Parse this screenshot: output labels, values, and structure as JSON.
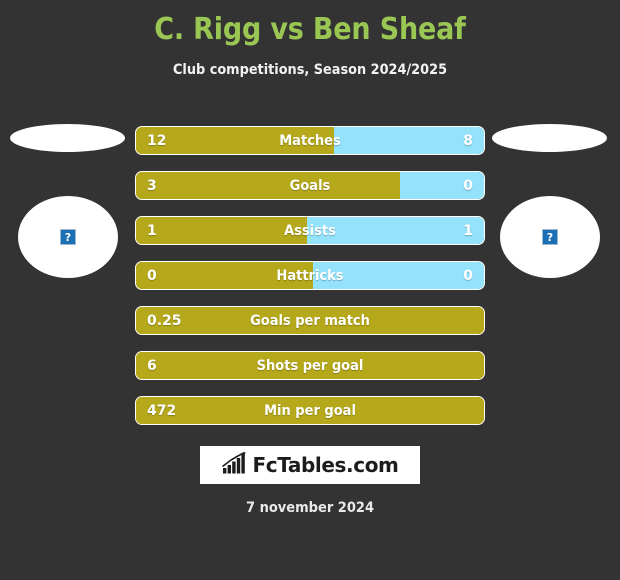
{
  "header": {
    "title": "C. Rigg vs Ben Sheaf",
    "subtitle": "Club competitions, Season 2024/2025",
    "title_color": "#9ac653"
  },
  "teams": {
    "home": {
      "club_badge_icon": "club-crest-placeholder",
      "player_photo_icon": "broken-image-icon",
      "broken_image_glyph": "?"
    },
    "away": {
      "club_badge_icon": "club-crest-placeholder",
      "player_photo_icon": "broken-image-icon",
      "broken_image_glyph": "?"
    }
  },
  "colors": {
    "background": "#333333",
    "home_bar": "#b5a81a",
    "away_bar": "#94e2fb",
    "bar_border": "#ffffff",
    "text": "#ffffff"
  },
  "chart_data": {
    "type": "bar",
    "title": "C. Rigg vs Ben Sheaf",
    "subtitle": "Club competitions, Season 2024/2025",
    "orientation": "horizontal-diverging",
    "legend": [
      "C. Rigg",
      "Ben Sheaf"
    ],
    "categories": [
      "Matches",
      "Goals",
      "Assists",
      "Hattricks",
      "Goals per match",
      "Shots per goal",
      "Min per goal"
    ],
    "series": [
      {
        "name": "C. Rigg",
        "values": [
          12,
          3,
          1,
          0,
          0.25,
          6,
          472
        ]
      },
      {
        "name": "Ben Sheaf",
        "values": [
          8,
          0,
          1,
          0,
          null,
          null,
          null
        ]
      }
    ],
    "home_share_pct": [
      57,
      76,
      49,
      51,
      100,
      100,
      100
    ]
  },
  "stats": [
    {
      "label": "Matches",
      "home": "12",
      "away": "8",
      "home_pct": 57,
      "has_away": true
    },
    {
      "label": "Goals",
      "home": "3",
      "away": "0",
      "home_pct": 76,
      "has_away": true
    },
    {
      "label": "Assists",
      "home": "1",
      "away": "1",
      "home_pct": 49,
      "has_away": true
    },
    {
      "label": "Hattricks",
      "home": "0",
      "away": "0",
      "home_pct": 51,
      "has_away": true
    },
    {
      "label": "Goals per match",
      "home": "0.25",
      "away": "",
      "home_pct": 100,
      "has_away": false
    },
    {
      "label": "Shots per goal",
      "home": "6",
      "away": "",
      "home_pct": 100,
      "has_away": false
    },
    {
      "label": "Min per goal",
      "home": "472",
      "away": "",
      "home_pct": 100,
      "has_away": false
    }
  ],
  "footer": {
    "logo_text": "FcTables.com",
    "logo_icon": "bar-chart-growth-icon",
    "date": "7 november 2024"
  }
}
